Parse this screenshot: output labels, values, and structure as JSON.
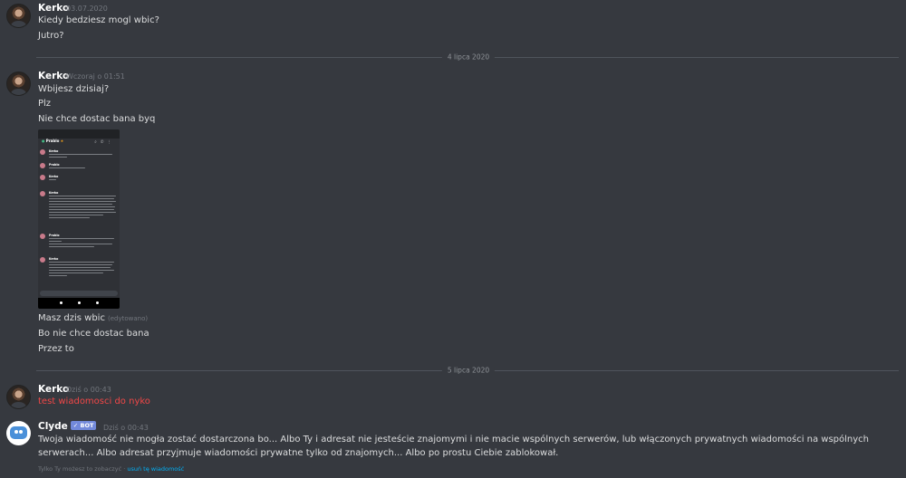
{
  "messages": [
    {
      "author": "Kerko",
      "timestamp": "03.07.2020",
      "lines": [
        "Kiedy bedziesz mogl wbic?",
        "Jutro?"
      ]
    },
    {
      "divider": "4 lipca 2020"
    },
    {
      "author": "Kerko",
      "timestamp": "Wczoraj o 01:51",
      "lines": [
        "Wbijesz dzisiaj?",
        "Plz",
        "Nie chce dostac bana byq"
      ],
      "attachment": {
        "type": "screenshot",
        "channel_title": "Prablo",
        "authors": [
          "Kerko",
          "Prablo",
          "Kerko",
          "Kerko",
          "Prablo",
          "Kerko"
        ]
      },
      "after_lines": [
        {
          "text": "Masz dzis wbic",
          "edited": "(edytowano)"
        },
        {
          "text": "Bo nie chce dostac bana"
        },
        {
          "text": "Przez to"
        }
      ]
    },
    {
      "divider": "5 lipca 2020"
    },
    {
      "author": "Kerko",
      "timestamp": "Dziś o 00:43",
      "lines": [
        "test wiadomosci do nyko"
      ],
      "failed": true,
      "failed_color": "#f04747"
    },
    {
      "author": "Clyde",
      "badge": "✓ BOT",
      "timestamp": "Dziś o 00:43",
      "lines": [
        "Twoja wiadomość nie mogła zostać dostarczona bo... Albo Ty i adresat nie jesteście znajomymi i nie macie wspólnych serwerów, lub włączonych prywatnych wiadomości na wspólnych serwerach... Albo adresat przyjmuje wiadomości prywatne tylko od znajomych... Albo po prostu Ciebie zablokował."
      ],
      "footer": {
        "text": "Tylko Ty możesz to zobaczyć · ",
        "link": "usuń tę wiadomość"
      }
    }
  ],
  "theme": {
    "background": "#36393f",
    "username": "#ffffff",
    "timestamp": "#72767d",
    "bot_badge": "#7289da",
    "link": "#00aff4"
  }
}
